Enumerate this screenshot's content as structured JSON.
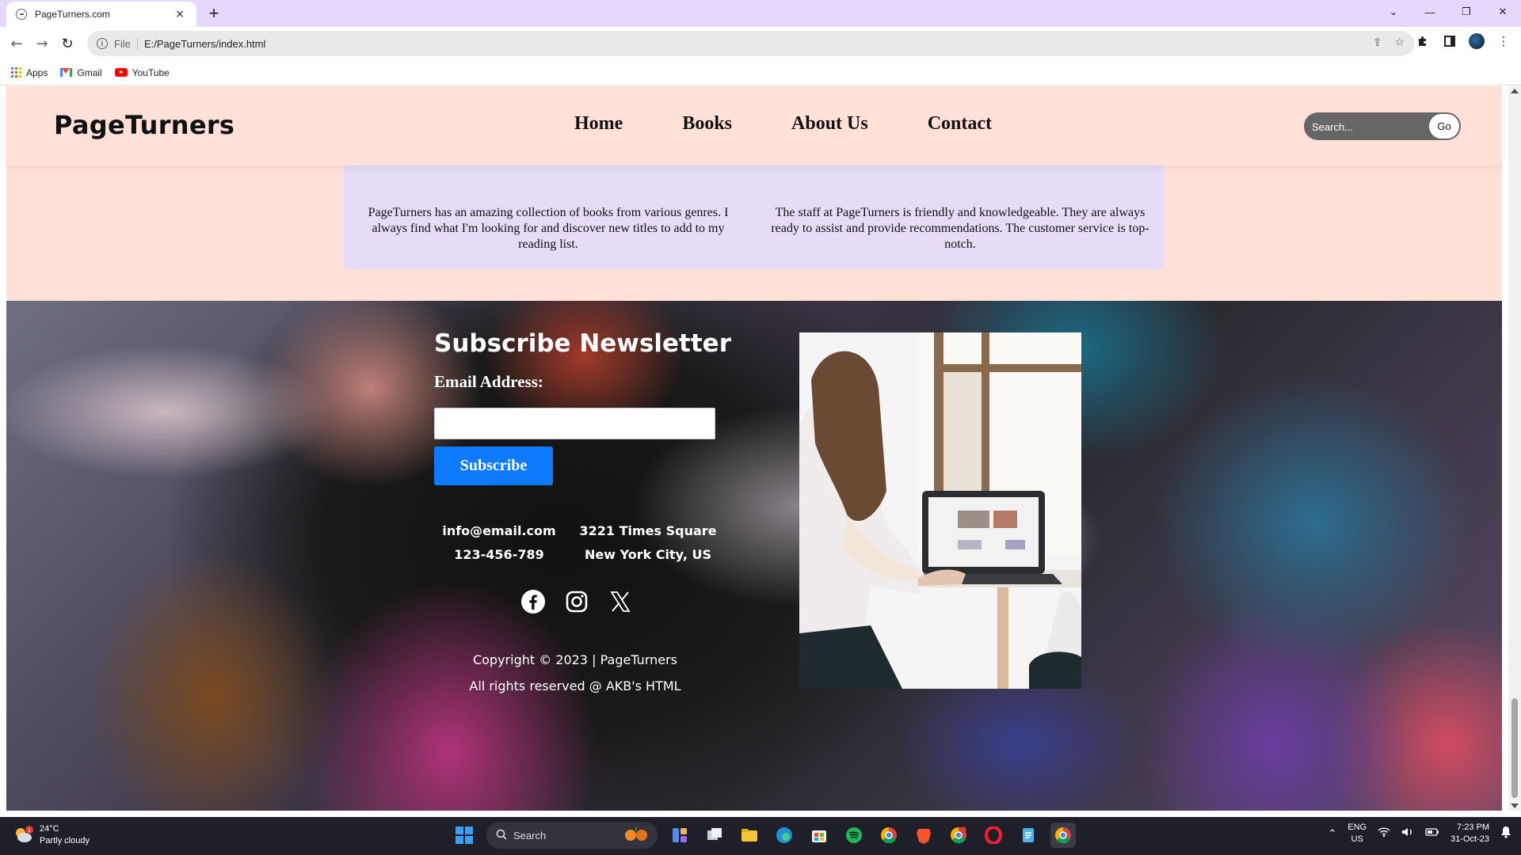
{
  "browser": {
    "tab_title": "PageTurners.com",
    "tab_close": "×",
    "new_tab": "+",
    "url_scheme": "File",
    "url": "E:/PageTurners/index.html",
    "window_controls": [
      "⌄",
      "—",
      "❐",
      "✕"
    ],
    "bookmarks": [
      {
        "label": "Apps",
        "icon": "apps-grid-icon"
      },
      {
        "label": "Gmail",
        "icon": "gmail-icon"
      },
      {
        "label": "YouTube",
        "icon": "youtube-icon"
      }
    ]
  },
  "site": {
    "logo": "PageTurners",
    "nav": [
      "Home",
      "Books",
      "About Us",
      "Contact"
    ],
    "search": {
      "placeholder": "Search...",
      "button": "Go"
    },
    "reviews": [
      "PageTurners has an amazing collection of books from various genres. I always find what I'm looking for and discover new titles to add to my reading list.",
      "The staff at PageTurners is friendly and knowledgeable. They are always ready to assist and provide recommendations. The customer service is top-notch."
    ]
  },
  "footer": {
    "newsletter_title": "Subscribe Newsletter",
    "email_label": "Email Address:",
    "email_value": "",
    "subscribe_button": "Subscribe",
    "contact": {
      "email": "info@email.com",
      "phone": "123-456-789",
      "address_line1": "3221 Times Square",
      "address_line2": "New York City, US"
    },
    "socials": [
      "facebook-icon",
      "instagram-icon",
      "x-twitter-icon"
    ],
    "copyright": "Copyright © 2023 | PageTurners",
    "rights": "All rights reserved @ AKB's HTML"
  },
  "taskbar": {
    "weather_temp": "24°C",
    "weather_desc": "Partly cloudy",
    "weather_badge": "1",
    "search_label": "Search",
    "lang_line1": "ENG",
    "lang_line2": "US",
    "time": "7:23 PM",
    "date": "31-Oct-23"
  },
  "colors": {
    "page_bg": "#ffe1d8",
    "reviews_bg": "#e6dcf8",
    "subscribe_button": "#0d7bff",
    "search_bg": "#666666",
    "tabbar": "#e5d8fb"
  }
}
